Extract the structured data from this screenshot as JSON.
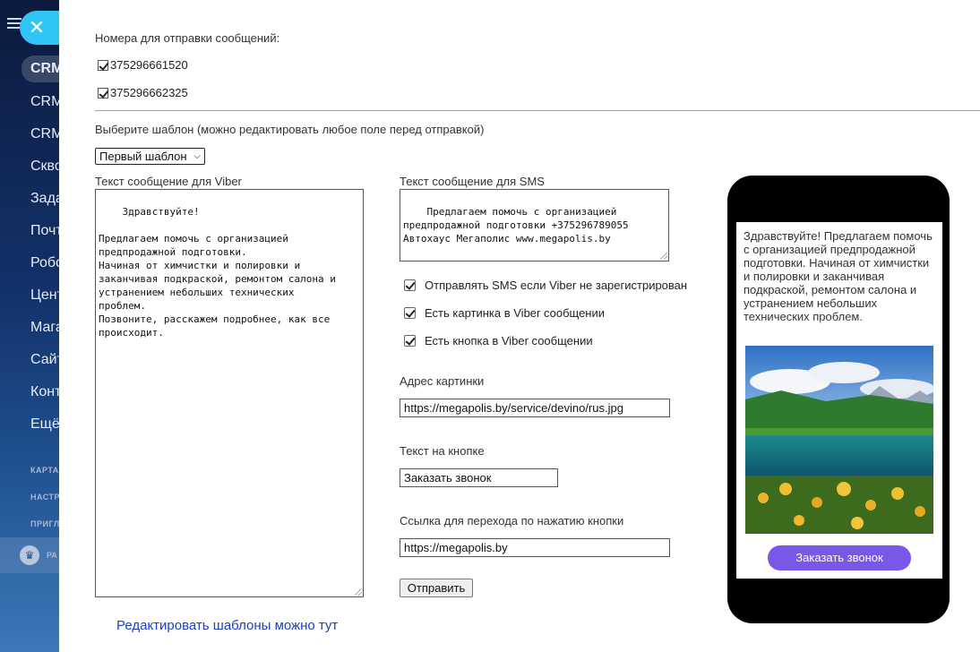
{
  "background_sidebar": {
    "active_item": "CRM",
    "items": [
      "CRM",
      "CRM",
      "Скво",
      "Зада",
      "Почт",
      "Робо",
      "Цент",
      "Мага",
      "Сайт",
      "Конт",
      "Ещё"
    ],
    "small_items": [
      "КАРТА",
      "НАСТР",
      "ПРИГЛ"
    ],
    "bottom_item": "РА"
  },
  "form": {
    "numbers_label": "Номера для отправки сообщений:",
    "numbers": [
      "375296661520",
      "375296662325"
    ],
    "template_label": "Выберите шаблон (можно редактировать любое поле перед отправкой)",
    "template_selected": "Первый шаблон",
    "viber_label": "Текст сообщение для Viber",
    "viber_text": "Здравствуйте!\n\nПредлагаем помочь с организацией\nпредпродажной подготовки.\nНачиная от химчистки и полировки и\nзаканчивая подкраской, ремонтом салона и\nустранением небольших технических\nпроблем.\nПозвоните, расскажем подробнее, как все\nпроисходит.",
    "sms_label": "Текст сообщение для SMS",
    "sms_text": "Предлагаем помочь с организацией\nпредпродажной подготовки +375296789055\nАвтохаус Мегаполис www.megapolis.by",
    "options": [
      "Отправлять SMS если Viber не зарегистрирован",
      "Есть картинка в Viber сообщении",
      "Есть кнопка в Viber сообщении"
    ],
    "image_url_label": "Адрес картинки",
    "image_url": "https://megapolis.by/service/devino/rus.jpg",
    "button_text_label": "Текст на кнопке",
    "button_text": "Заказать звонок",
    "button_link_label": "Ссылка для перехода по нажатию кнопки",
    "button_link": "https://megapolis.by",
    "send_label": "Отправить",
    "edit_templates_link": "Редактировать шаблоны можно тут"
  },
  "preview": {
    "text": "Здравствуйте! Предлагаем помочь с организацией предпродажной подготовки. Начиная от химчистки и полировки и заканчивая подкраской, ремонтом салона и устранением небольших технических проблем.",
    "button_label": "Заказать звонок",
    "button_color": "#7b57e8"
  },
  "colors": {
    "close_button": "#2fc6f6",
    "link": "#1a3fc7"
  }
}
